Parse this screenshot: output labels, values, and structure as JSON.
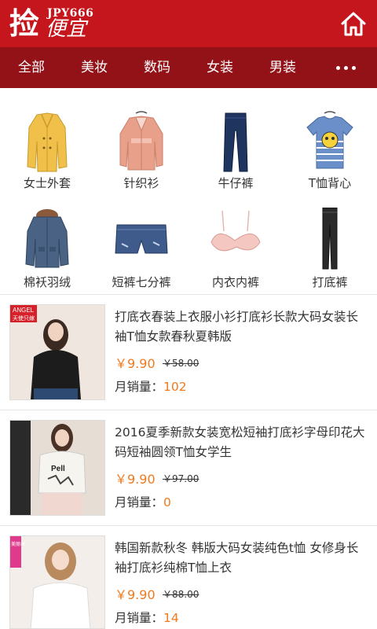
{
  "header": {
    "logo_char": "捡",
    "logo_code": "JPY666",
    "logo_word": "便宜",
    "home_icon": "home-icon"
  },
  "nav": {
    "items": [
      "全部",
      "美妆",
      "数码",
      "女装",
      "男装"
    ],
    "more_icon": "more-dots-icon"
  },
  "categories": [
    {
      "label": "女士外套",
      "icon": "coat-image"
    },
    {
      "label": "针织衫",
      "icon": "cardigan-image"
    },
    {
      "label": "牛仔裤",
      "icon": "jeans-image"
    },
    {
      "label": "T恤背心",
      "icon": "tshirt-image"
    },
    {
      "label": "棉袄羽绒",
      "icon": "down-jacket-image"
    },
    {
      "label": "短裤七分裤",
      "icon": "shorts-image"
    },
    {
      "label": "内衣内裤",
      "icon": "bra-image"
    },
    {
      "label": "打底裤",
      "icon": "leggings-image"
    }
  ],
  "products": [
    {
      "title": "打底衣春装上衣服小衫打底衫长款大码女装长袖T恤女款春秋夏韩版",
      "price": "￥9.90",
      "old_price": "￥58.00",
      "sales_label": "月销量：",
      "sales_count": "102",
      "badge": "ANGEL\n天使只嫁"
    },
    {
      "title": "2016夏季新款女装宽松短袖打底衫字母印花大码短袖圆领T恤女学生",
      "price": "￥9.90",
      "old_price": "￥97.00",
      "sales_label": "月销量：",
      "sales_count": "0",
      "badge": ""
    },
    {
      "title": "韩国新款秋冬 韩版大码女装纯色t恤 女修身长袖打底衫纯棉T恤上衣",
      "price": "￥9.90",
      "old_price": "￥88.00",
      "sales_label": "月销量：",
      "sales_count": "14",
      "badge": "美丽丝"
    }
  ],
  "colors": {
    "header_bg": "#c6161d",
    "nav_bg": "#931217",
    "price": "#f07a1f"
  }
}
